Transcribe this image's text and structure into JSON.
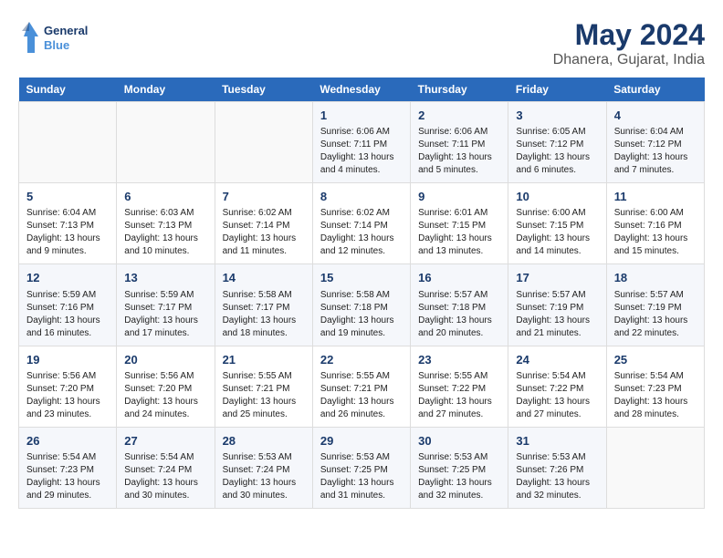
{
  "logo": {
    "line1": "General",
    "line2": "Blue"
  },
  "title": "May 2024",
  "subtitle": "Dhanera, Gujarat, India",
  "headers": [
    "Sunday",
    "Monday",
    "Tuesday",
    "Wednesday",
    "Thursday",
    "Friday",
    "Saturday"
  ],
  "weeks": [
    [
      {
        "num": "",
        "content": ""
      },
      {
        "num": "",
        "content": ""
      },
      {
        "num": "",
        "content": ""
      },
      {
        "num": "1",
        "content": "Sunrise: 6:06 AM\nSunset: 7:11 PM\nDaylight: 13 hours\nand 4 minutes."
      },
      {
        "num": "2",
        "content": "Sunrise: 6:06 AM\nSunset: 7:11 PM\nDaylight: 13 hours\nand 5 minutes."
      },
      {
        "num": "3",
        "content": "Sunrise: 6:05 AM\nSunset: 7:12 PM\nDaylight: 13 hours\nand 6 minutes."
      },
      {
        "num": "4",
        "content": "Sunrise: 6:04 AM\nSunset: 7:12 PM\nDaylight: 13 hours\nand 7 minutes."
      }
    ],
    [
      {
        "num": "5",
        "content": "Sunrise: 6:04 AM\nSunset: 7:13 PM\nDaylight: 13 hours\nand 9 minutes."
      },
      {
        "num": "6",
        "content": "Sunrise: 6:03 AM\nSunset: 7:13 PM\nDaylight: 13 hours\nand 10 minutes."
      },
      {
        "num": "7",
        "content": "Sunrise: 6:02 AM\nSunset: 7:14 PM\nDaylight: 13 hours\nand 11 minutes."
      },
      {
        "num": "8",
        "content": "Sunrise: 6:02 AM\nSunset: 7:14 PM\nDaylight: 13 hours\nand 12 minutes."
      },
      {
        "num": "9",
        "content": "Sunrise: 6:01 AM\nSunset: 7:15 PM\nDaylight: 13 hours\nand 13 minutes."
      },
      {
        "num": "10",
        "content": "Sunrise: 6:00 AM\nSunset: 7:15 PM\nDaylight: 13 hours\nand 14 minutes."
      },
      {
        "num": "11",
        "content": "Sunrise: 6:00 AM\nSunset: 7:16 PM\nDaylight: 13 hours\nand 15 minutes."
      }
    ],
    [
      {
        "num": "12",
        "content": "Sunrise: 5:59 AM\nSunset: 7:16 PM\nDaylight: 13 hours\nand 16 minutes."
      },
      {
        "num": "13",
        "content": "Sunrise: 5:59 AM\nSunset: 7:17 PM\nDaylight: 13 hours\nand 17 minutes."
      },
      {
        "num": "14",
        "content": "Sunrise: 5:58 AM\nSunset: 7:17 PM\nDaylight: 13 hours\nand 18 minutes."
      },
      {
        "num": "15",
        "content": "Sunrise: 5:58 AM\nSunset: 7:18 PM\nDaylight: 13 hours\nand 19 minutes."
      },
      {
        "num": "16",
        "content": "Sunrise: 5:57 AM\nSunset: 7:18 PM\nDaylight: 13 hours\nand 20 minutes."
      },
      {
        "num": "17",
        "content": "Sunrise: 5:57 AM\nSunset: 7:19 PM\nDaylight: 13 hours\nand 21 minutes."
      },
      {
        "num": "18",
        "content": "Sunrise: 5:57 AM\nSunset: 7:19 PM\nDaylight: 13 hours\nand 22 minutes."
      }
    ],
    [
      {
        "num": "19",
        "content": "Sunrise: 5:56 AM\nSunset: 7:20 PM\nDaylight: 13 hours\nand 23 minutes."
      },
      {
        "num": "20",
        "content": "Sunrise: 5:56 AM\nSunset: 7:20 PM\nDaylight: 13 hours\nand 24 minutes."
      },
      {
        "num": "21",
        "content": "Sunrise: 5:55 AM\nSunset: 7:21 PM\nDaylight: 13 hours\nand 25 minutes."
      },
      {
        "num": "22",
        "content": "Sunrise: 5:55 AM\nSunset: 7:21 PM\nDaylight: 13 hours\nand 26 minutes."
      },
      {
        "num": "23",
        "content": "Sunrise: 5:55 AM\nSunset: 7:22 PM\nDaylight: 13 hours\nand 27 minutes."
      },
      {
        "num": "24",
        "content": "Sunrise: 5:54 AM\nSunset: 7:22 PM\nDaylight: 13 hours\nand 27 minutes."
      },
      {
        "num": "25",
        "content": "Sunrise: 5:54 AM\nSunset: 7:23 PM\nDaylight: 13 hours\nand 28 minutes."
      }
    ],
    [
      {
        "num": "26",
        "content": "Sunrise: 5:54 AM\nSunset: 7:23 PM\nDaylight: 13 hours\nand 29 minutes."
      },
      {
        "num": "27",
        "content": "Sunrise: 5:54 AM\nSunset: 7:24 PM\nDaylight: 13 hours\nand 30 minutes."
      },
      {
        "num": "28",
        "content": "Sunrise: 5:53 AM\nSunset: 7:24 PM\nDaylight: 13 hours\nand 30 minutes."
      },
      {
        "num": "29",
        "content": "Sunrise: 5:53 AM\nSunset: 7:25 PM\nDaylight: 13 hours\nand 31 minutes."
      },
      {
        "num": "30",
        "content": "Sunrise: 5:53 AM\nSunset: 7:25 PM\nDaylight: 13 hours\nand 32 minutes."
      },
      {
        "num": "31",
        "content": "Sunrise: 5:53 AM\nSunset: 7:26 PM\nDaylight: 13 hours\nand 32 minutes."
      },
      {
        "num": "",
        "content": ""
      }
    ]
  ]
}
